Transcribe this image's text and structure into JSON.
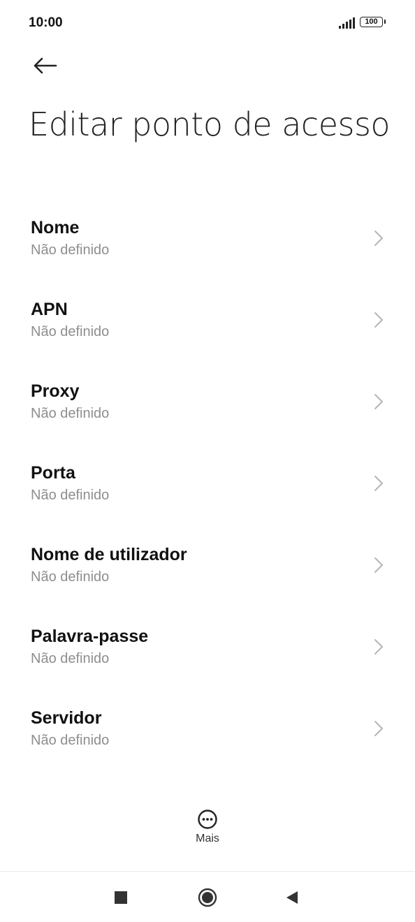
{
  "status_bar": {
    "time": "10:00",
    "battery_level": "100",
    "signal_icon": "signal-bars-icon"
  },
  "header": {
    "back_icon": "arrow-left-icon",
    "title": "Editar ponto de acesso"
  },
  "settings": [
    {
      "label": "Nome",
      "value": "Não definido"
    },
    {
      "label": "APN",
      "value": "Não definido"
    },
    {
      "label": "Proxy",
      "value": "Não definido"
    },
    {
      "label": "Porta",
      "value": "Não definido"
    },
    {
      "label": "Nome de utilizador",
      "value": "Não definido"
    },
    {
      "label": "Palavra-passe",
      "value": "Não definido"
    },
    {
      "label": "Servidor",
      "value": "Não definido"
    }
  ],
  "footer": {
    "more_label": "Mais",
    "more_icon": "more-dots-icon"
  },
  "nav_bar": {
    "recents_icon": "square-icon",
    "home_icon": "circle-icon",
    "back_icon": "triangle-back-icon"
  },
  "colors": {
    "text_primary": "#111111",
    "text_secondary": "#8e8e8e",
    "chevron": "#b5b5b5",
    "background": "#ffffff"
  }
}
